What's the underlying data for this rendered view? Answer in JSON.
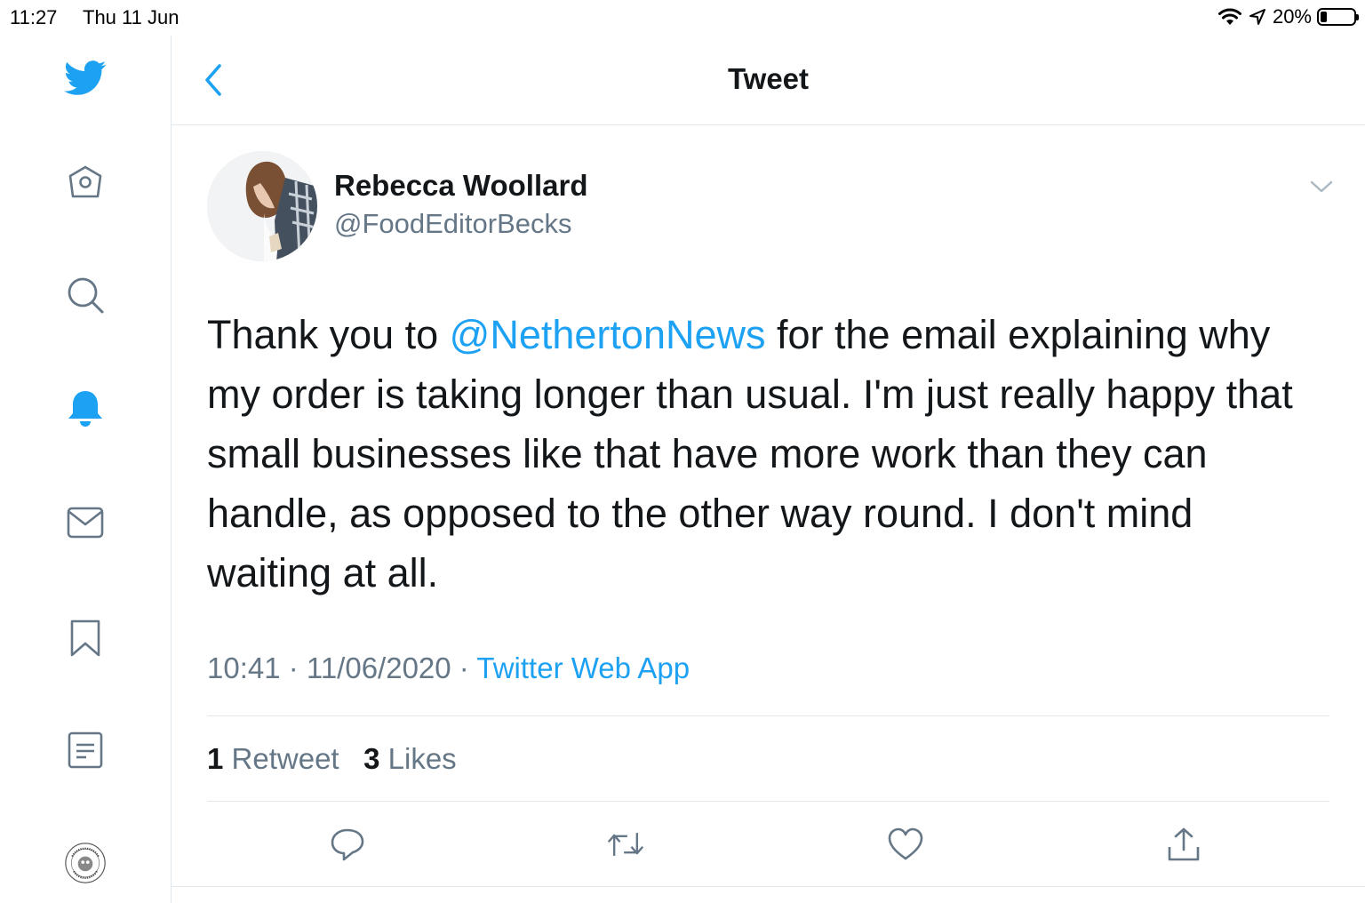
{
  "status_bar": {
    "time": "11:27",
    "date": "Thu 11 Jun",
    "battery": "20%",
    "battery_level": 0.2
  },
  "header": {
    "title": "Tweet"
  },
  "sidebar": {
    "icons": [
      "twitter-logo-icon",
      "home-icon",
      "search-icon",
      "notifications-bell-icon",
      "messages-envelope-icon",
      "bookmark-icon",
      "lists-icon",
      "profile-avatar-icon"
    ]
  },
  "tweet": {
    "author_name": "Rebecca Woollard",
    "author_handle": "@FoodEditorBecks",
    "text_before": "Thank you to ",
    "mention": "@NethertonNews",
    "text_after": " for the email explaining why my order is taking longer than usual. I'm just really happy that small businesses like that have more work than they can handle, as opposed to the other way round. I don't mind waiting at all.",
    "time": "10:41",
    "date": "11/06/2020",
    "separator": " · ",
    "source": "Twitter Web App",
    "retweet_count": "1",
    "retweet_label": "Retweet",
    "like_count": "3",
    "like_label": "Likes"
  },
  "colors": {
    "accent": "#1da1f2",
    "secondary_text": "#657786",
    "primary_text": "#14171a",
    "divider": "#e1e8ed"
  }
}
